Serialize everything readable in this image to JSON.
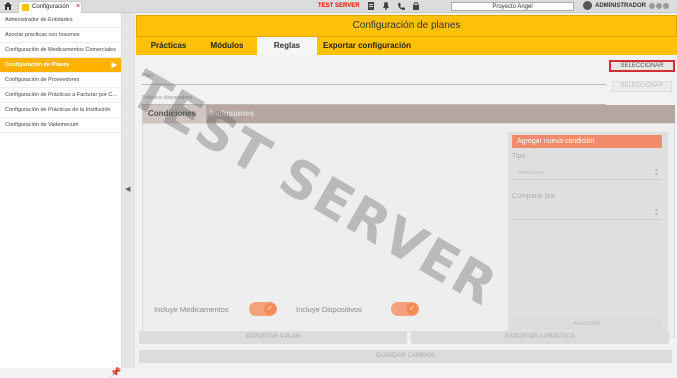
{
  "topbar": {
    "tab_label": "Configuración",
    "tab_close": "×",
    "server_label": "TEST SERVER",
    "project": "Proyecto Angel",
    "user": "ADMINISTRADOR"
  },
  "sidebar": {
    "items": [
      {
        "label": "Administrador de Entidades"
      },
      {
        "label": "Asociar practicas con Insumos"
      },
      {
        "label": "Configuración de Medicamentos Comerciales"
      },
      {
        "label": "Configuración de Planes"
      },
      {
        "label": "Configuración de Proveedores"
      },
      {
        "label": "Configuración de Prácticas a Facturar por C..."
      },
      {
        "label": "Configuración de Prácticas de la Institución"
      },
      {
        "label": "Configuración de Vademecum"
      }
    ],
    "active_index": 3
  },
  "main": {
    "title": "Configuración de planes",
    "tabs": [
      {
        "label": "Prácticas"
      },
      {
        "label": "Módulos"
      },
      {
        "label": "Reglas"
      },
      {
        "label": "Exportar configuración"
      }
    ],
    "plan_label": "Plan",
    "practice_label": "Práctica disparadora",
    "select_button": "SELECCIONAR",
    "select_button_2": "SELECCIONAR",
    "subtabs": [
      {
        "label": "Condiciones"
      },
      {
        "label": "Inclusiones"
      }
    ],
    "add_condition": "Agregar nueva condición",
    "tipo_label": "Tipo",
    "tipo_value": "Seleccione",
    "comparar_label": "Comparar por",
    "add_button": "AGREGAR",
    "toggle_meds_label": "Incluye Medicamentos",
    "toggle_devices_label": "Incluye Dispositivos",
    "export_plan": "EXPORTAR A PLAN",
    "export_practice": "EXPORTAR A PRÁCTICA",
    "save_changes": "GUARDAR CAMBIOS"
  },
  "watermark": "TEST SERVER",
  "colors": {
    "accent": "#ffc107",
    "active_sidebar": "#ffb300",
    "condition_button": "#f28b6a",
    "toggle": "#f58a55",
    "server_label": "#ee0000"
  }
}
